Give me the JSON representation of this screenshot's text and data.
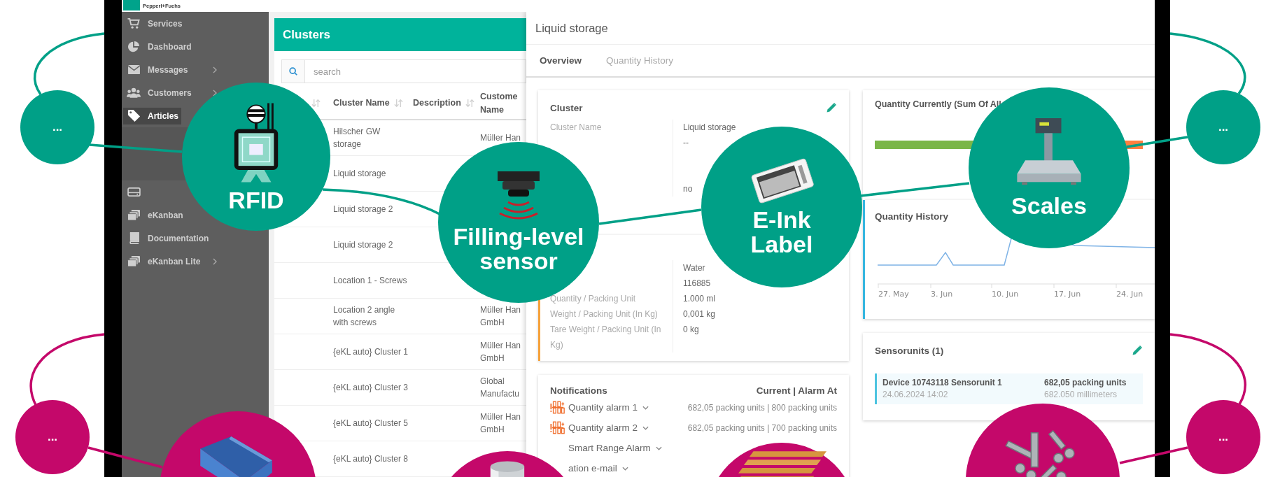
{
  "logo": {
    "text": "Pepperl+Fuchs"
  },
  "sidebar": {
    "items": [
      {
        "label": "Services",
        "selected": false,
        "submenu": false,
        "expanded": false
      },
      {
        "label": "Dashboard",
        "selected": false,
        "submenu": false,
        "expanded": false
      },
      {
        "label": "Messages",
        "selected": false,
        "submenu": true,
        "expanded": false
      },
      {
        "label": "Customers",
        "selected": false,
        "submenu": true,
        "expanded": false
      },
      {
        "label": "Articles",
        "selected": true,
        "submenu": false,
        "expanded": true
      },
      {
        "selected": false,
        "submenu": false,
        "expanded": false
      },
      {
        "label": "eKanban",
        "selected": false,
        "submenu": false,
        "expanded": false
      },
      {
        "label": "Documentation",
        "selected": false,
        "submenu": false,
        "expanded": false
      },
      {
        "label": "eKanban Lite",
        "selected": false,
        "submenu": true,
        "expanded": false
      }
    ]
  },
  "clusters": {
    "title": "Clusters",
    "search": {
      "placeholder": "search"
    },
    "columns": [
      {
        "sortable": true
      },
      {
        "label": "Cluster Name",
        "sortable": true
      },
      {
        "label": "Description",
        "sortable": true
      },
      {
        "label": "Custome Name",
        "sortable": false
      }
    ],
    "rows": [
      {
        "cluster_name": "Hilscher GW storage",
        "customer_name": "Müller Han"
      },
      {
        "cluster_name": "Liquid storage"
      },
      {
        "cluster_name": "Liquid storage 2"
      },
      {
        "cluster_name": "Liquid storage 2"
      },
      {
        "cluster_name": "Location 1 - Screws"
      },
      {
        "cluster_name": "Location 2 angle with screws",
        "customer_name": "Müller Han GmbH"
      },
      {
        "cluster_name": "{eKL auto} Cluster 1",
        "customer_name": "Müller Han GmbH"
      },
      {
        "cluster_name": "{eKL auto} Cluster 3",
        "customer_name": "Global Manufactu"
      },
      {
        "cluster_name": "{eKL auto} Cluster 5",
        "customer_name": "Müller Han GmbH"
      },
      {
        "cluster_name": "{eKL auto} Cluster 8"
      }
    ]
  },
  "detail": {
    "title": "Liquid storage",
    "tabs": [
      {
        "label": "Overview",
        "selected": true
      },
      {
        "label": "Quantity History",
        "selected": false
      }
    ],
    "cluster_card": {
      "title": "Cluster",
      "rows": [
        {
          "label": "Cluster Name",
          "value": "Liquid storage"
        },
        {
          "value": "--"
        },
        {},
        {},
        {
          "value": "no"
        }
      ]
    },
    "article_card": {
      "rows": [
        {
          "value": "Water"
        },
        {
          "value": "116885"
        },
        {
          "label": "Quantity / Packing Unit",
          "value": "1.000 ml"
        },
        {
          "label": "Weight / Packing Unit (In Kg)",
          "value": "0,001 kg"
        },
        {
          "label": "Tare Weight / Packing Unit (In Kg)",
          "value": "0 kg"
        }
      ]
    },
    "notifications": {
      "title": "Notifications",
      "header_right": "Current | Alarm At",
      "items": [
        {
          "kind": "quantity",
          "label": "Quantity alarm 1",
          "value": "682,05 packing units | 800 packing units"
        },
        {
          "kind": "quantity",
          "label": "Quantity alarm 2",
          "value": "682,05 packing units | 700 packing units"
        },
        {
          "kind": "covered",
          "label": "Smart Range Alarm"
        },
        {
          "kind": "covered",
          "label": "ation e-mail"
        }
      ]
    },
    "quantity_card": {
      "title": "Quantity Currently (Sum Of All",
      "level": 0.7
    },
    "history_card": {
      "title": "Quantity History",
      "x_ticks": [
        "27. May",
        "3. Jun",
        "10. Jun",
        "17. Jun",
        "24. Jun"
      ]
    },
    "sensorunits": {
      "title": "Sensorunits (1)",
      "units": [
        {
          "name": "Device 10743118 Sensorunit 1",
          "time": "24.06.2024 14:02",
          "quantity": "682,05 packing units",
          "reading": "682.050 millimeters"
        }
      ]
    }
  },
  "overlay": {
    "circles": [
      {
        "kind": "dot",
        "label": "...",
        "color": "#00a087"
      },
      {
        "kind": "rfid",
        "label": "RFID",
        "color": "#00a087"
      },
      {
        "kind": "sensor",
        "label": "Filling-level sensor",
        "color": "#00a087"
      },
      {
        "kind": "eink",
        "label": "E-Ink Label",
        "color": "#00a087"
      },
      {
        "kind": "scales",
        "label": "Scales",
        "color": "#00a087"
      },
      {
        "kind": "dot",
        "label": "...",
        "color": "#00a087"
      },
      {
        "kind": "dot",
        "label": "...",
        "color": "#c4086a"
      },
      {
        "kind": "bin",
        "color": "#c4086a"
      },
      {
        "kind": "tank",
        "color": "#c4086a"
      },
      {
        "kind": "pallet",
        "color": "#c4086a"
      },
      {
        "kind": "screws",
        "color": "#c4086a"
      },
      {
        "kind": "dot",
        "label": "...",
        "color": "#c4086a"
      }
    ]
  }
}
